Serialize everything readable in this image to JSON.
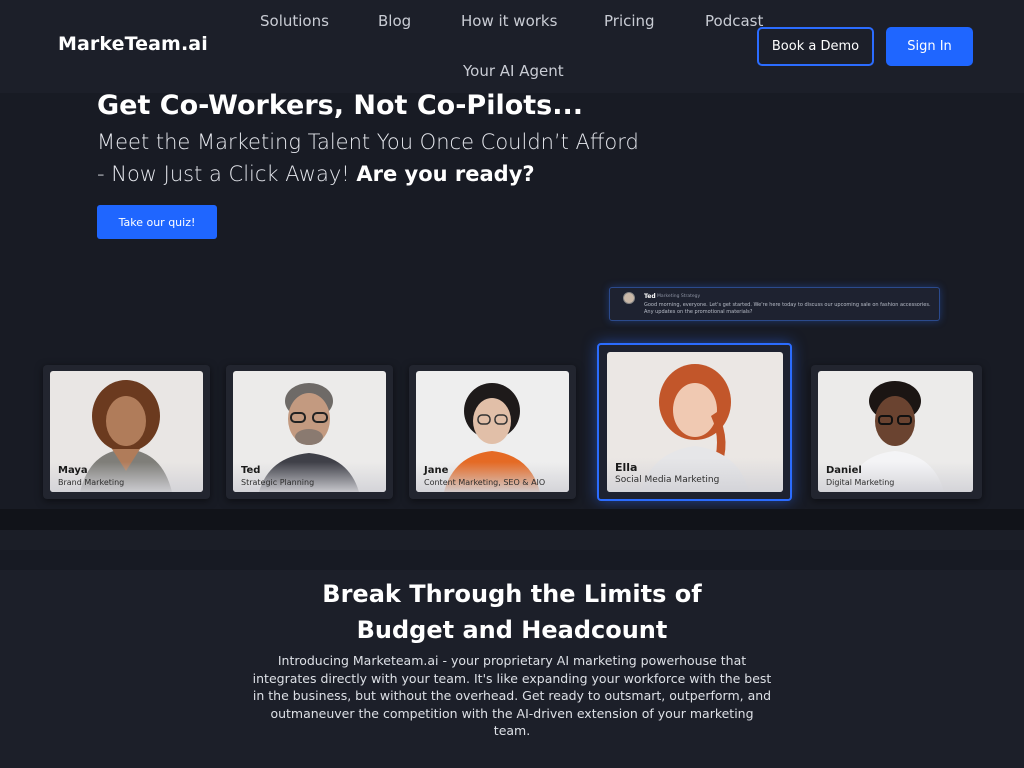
{
  "header": {
    "logo": "MarkeTeam.ai",
    "nav": [
      "Solutions",
      "Blog",
      "How it works",
      "Pricing",
      "Podcast",
      "Your AI Agent"
    ],
    "book_demo": "Book a Demo",
    "sign_in": "Sign In"
  },
  "hero": {
    "title": "Get Co-Workers, Not Co-Pilots...",
    "subtitle_line1": "Meet the Marketing Talent You Once Couldn’t Afford",
    "subtitle_line2": "- Now Just a Click Away!",
    "subtitle_strong": "Are you ready?",
    "quiz_button": "Take our quiz!"
  },
  "chat": {
    "name": "Ted",
    "role": "Marketing Strategy",
    "text": "Good morning, everyone. Let's get started. We're here today to discuss our upcoming sale on fashion accessories. Any updates on the promotional materials?"
  },
  "agents": [
    {
      "name": "Maya",
      "role": "Brand Marketing"
    },
    {
      "name": "Ted",
      "role": "Strategic Planning"
    },
    {
      "name": "Jane",
      "role": "Content Marketing, SEO & AIO"
    },
    {
      "name": "Ella",
      "role": "Social Media Marketing"
    },
    {
      "name": "Daniel",
      "role": "Digital Marketing"
    }
  ],
  "section": {
    "title_line1": "Break Through the Limits of",
    "title_line2": "Budget and Headcount",
    "text": "Introducing Marketeam.ai - your proprietary AI marketing powerhouse that integrates directly with your team. It's like expanding your workforce with the best in the business, but without the overhead. Get ready to outsmart, outperform, and outmaneuver the competition with the AI-driven extension of your marketing team."
  },
  "colors": {
    "accent": "#1f66ff",
    "background": "#171a23"
  }
}
